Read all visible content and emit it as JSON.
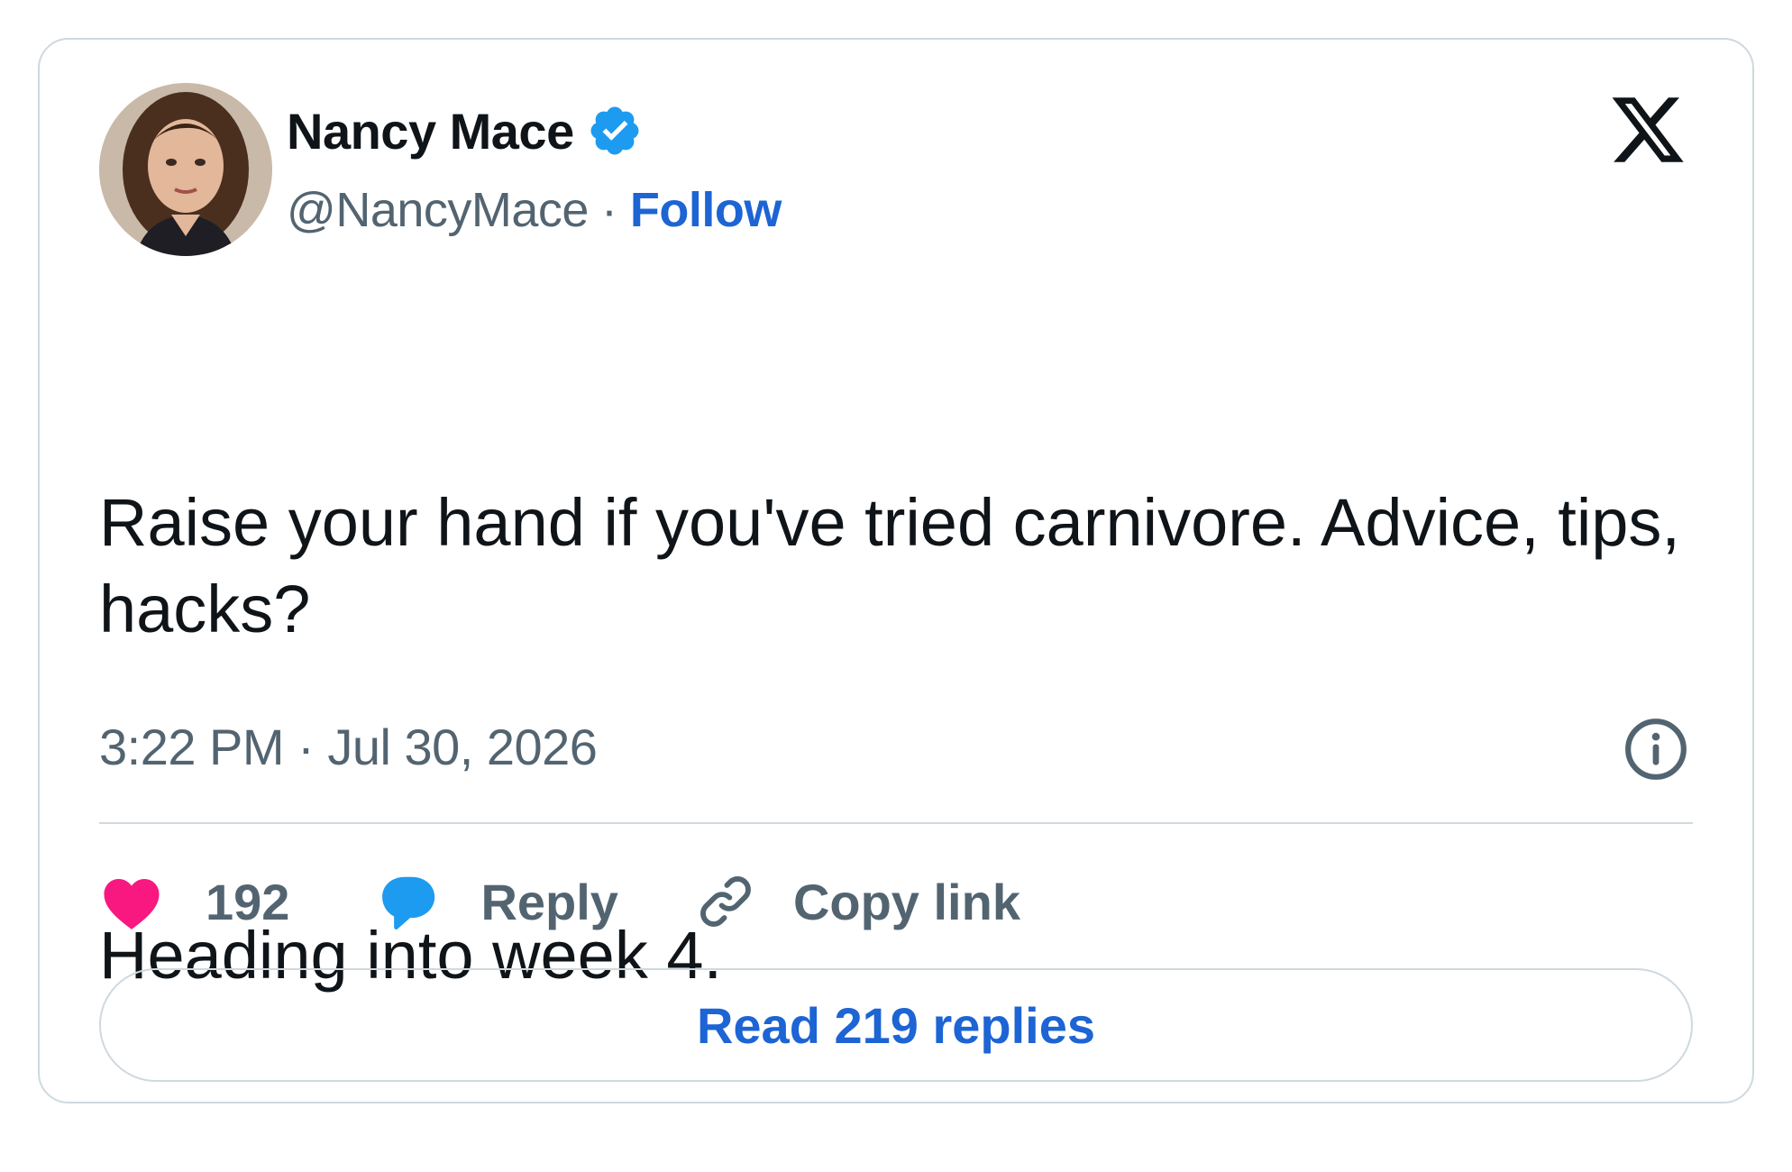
{
  "author": {
    "name": "Nancy Mace",
    "handle": "@NancyMace",
    "separator": "·",
    "follow_label": "Follow",
    "verified_icon": "verified-badge-icon",
    "avatar": "avatar-photo"
  },
  "tweet": {
    "paragraphs": [
      "Raise your hand if you've tried carnivore. Advice, tips, hacks?",
      "Heading into week 4."
    ],
    "timestamp": "3:22 PM · Jul 30, 2026"
  },
  "actions": {
    "like_count": "192",
    "reply_label": "Reply",
    "copy_label": "Copy link"
  },
  "read_replies_label": "Read 219 replies",
  "icons": {
    "like": "heart-icon",
    "reply": "speech-bubble-icon",
    "copy": "link-icon",
    "info": "info-icon",
    "brand": "x-logo-icon"
  },
  "colors": {
    "like": "#f91880",
    "reply": "#1d9bf0",
    "link": "#1d64d4",
    "secondary_text": "#536471",
    "border": "#cfd9de",
    "verified": "#1d9bf0"
  }
}
